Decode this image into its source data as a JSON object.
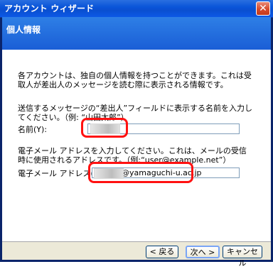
{
  "window": {
    "title": "アカウント ウィザード",
    "close_glyph": "✕"
  },
  "header": {
    "title": "個人情報"
  },
  "body": {
    "intro": "各アカウントは、独自の個人情報を持つことができます。これは受取人が差出人のメッセージを読む際に表示される情報です。",
    "name_prompt": "送信するメッセージの“差出人”フィールドに表示する名前を入力してください。（例: “山田太郎”）",
    "name_label": "名前(Y):",
    "name_value": "",
    "email_prompt": "電子メール アドレスを入力してください。これは、メールの受信時に使用されるアドレスです。（例:“user@example.net”）",
    "email_label": "電子メール アドレス(E):",
    "email_value": "@yamaguchi-u.ac.jp"
  },
  "buttons": {
    "back": "< 戻る",
    "next": "次へ >",
    "cancel": "キャンセル"
  },
  "colors": {
    "highlight": "#ff1111",
    "header_blue": "#1a5ed6"
  }
}
